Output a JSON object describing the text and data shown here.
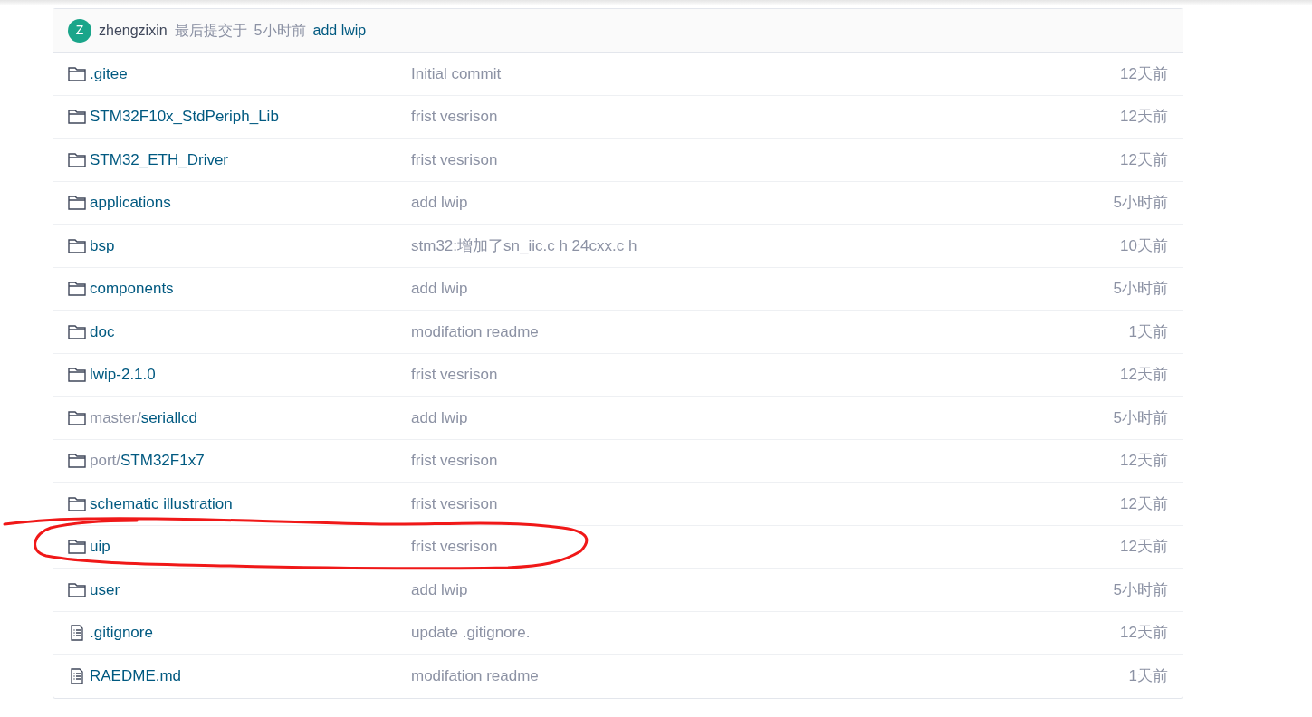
{
  "last_commit": {
    "avatar_letter": "Z",
    "author": "zhengzixin",
    "label": "最后提交于",
    "time": "5小时前",
    "message": "add lwip"
  },
  "entries": [
    {
      "kind": "folder",
      "name": ".gitee",
      "message": "Initial commit",
      "time": "12天前",
      "circled": false
    },
    {
      "kind": "folder",
      "name": "STM32F10x_StdPeriph_Lib",
      "message": "frist vesrison",
      "time": "12天前",
      "circled": false
    },
    {
      "kind": "folder",
      "name": "STM32_ETH_Driver",
      "message": "frist vesrison",
      "time": "12天前",
      "circled": false
    },
    {
      "kind": "folder",
      "name": "applications",
      "message": "add lwip",
      "time": "5小时前",
      "circled": false
    },
    {
      "kind": "folder",
      "name": "bsp",
      "message": "stm32:增加了sn_iic.c h 24cxx.c h",
      "time": "10天前",
      "circled": false
    },
    {
      "kind": "folder",
      "name": "components",
      "message": "add lwip",
      "time": "5小时前",
      "circled": false
    },
    {
      "kind": "folder",
      "name": "doc",
      "message": "modifation readme",
      "time": "1天前",
      "circled": false
    },
    {
      "kind": "folder",
      "name": "lwip-2.1.0",
      "message": "frist vesrison",
      "time": "12天前",
      "circled": false
    },
    {
      "kind": "folder",
      "prefix": "master/",
      "name": "seriallcd",
      "message": "add lwip",
      "time": "5小时前",
      "circled": false
    },
    {
      "kind": "folder",
      "prefix": "port/",
      "name": "STM32F1x7",
      "message": "frist vesrison",
      "time": "12天前",
      "circled": false
    },
    {
      "kind": "folder",
      "name": "schematic illustration",
      "message": "frist vesrison",
      "time": "12天前",
      "circled": false
    },
    {
      "kind": "folder",
      "name": "uip",
      "message": "frist vesrison",
      "time": "12天前",
      "circled": true
    },
    {
      "kind": "folder",
      "name": "user",
      "message": "add lwip",
      "time": "5小时前",
      "circled": false
    },
    {
      "kind": "file",
      "name": ".gitignore",
      "message": "update .gitignore.",
      "time": "12天前",
      "circled": false
    },
    {
      "kind": "file",
      "name": "RAEDME.md",
      "message": "modifation readme",
      "time": "1天前",
      "circled": false
    }
  ]
}
